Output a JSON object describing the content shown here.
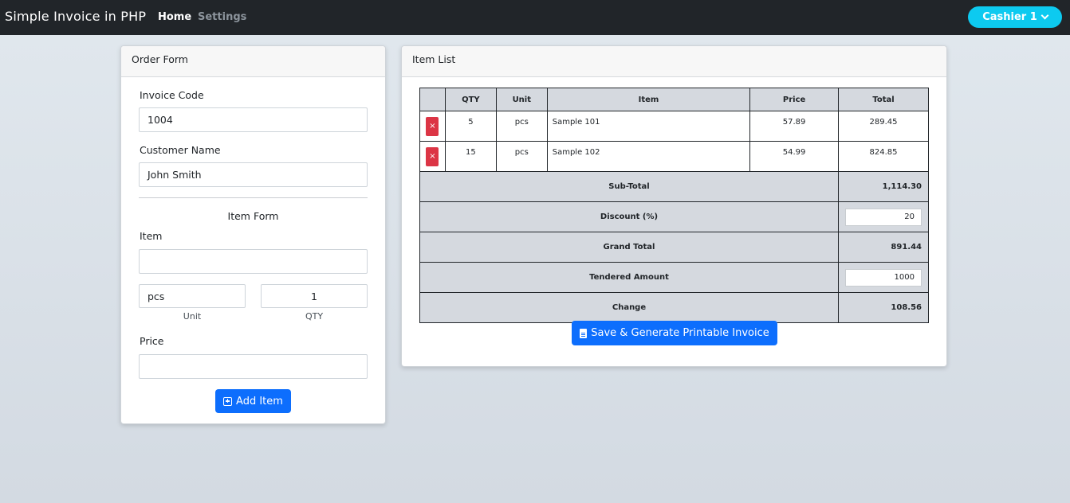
{
  "navbar": {
    "brand": "Simple Invoice in PHP",
    "links": [
      "Home",
      "Settings"
    ],
    "user": "Cashier 1"
  },
  "order_form": {
    "title": "Order Form",
    "invoice_code_label": "Invoice Code",
    "invoice_code_value": "1004",
    "customer_name_label": "Customer Name",
    "customer_name_value": "John Smith",
    "item_form_title": "Item Form",
    "item_label": "Item",
    "item_value": "",
    "unit_value": "pcs",
    "qty_value": "1",
    "unit_label": "Unit",
    "qty_label": "QTY",
    "price_label": "Price",
    "price_value": "",
    "add_item_label": "Add Item"
  },
  "item_list": {
    "title": "Item List",
    "columns": [
      "",
      "QTY",
      "Unit",
      "Item",
      "Price",
      "Total"
    ],
    "rows": [
      {
        "qty": "5",
        "unit": "pcs",
        "item": "Sample 101",
        "price": "57.89",
        "total": "289.45"
      },
      {
        "qty": "15",
        "unit": "pcs",
        "item": "Sample 102",
        "price": "54.99",
        "total": "824.85"
      }
    ],
    "delete_glyph": "×",
    "subtotal_label": "Sub-Total",
    "subtotal_value": "1,114.30",
    "discount_label": "Discount (%)",
    "discount_value": "20",
    "grand_total_label": "Grand Total",
    "grand_total_value": "891.44",
    "tendered_label": "Tendered Amount",
    "tendered_value": "1000",
    "change_label": "Change",
    "change_value": "108.56",
    "save_label": "Save & Generate Printable Invoice"
  },
  "colors": {
    "navbar": "#212529",
    "user_button": "#0dcaf0",
    "primary": "#0d6efd",
    "danger": "#dc3545"
  }
}
